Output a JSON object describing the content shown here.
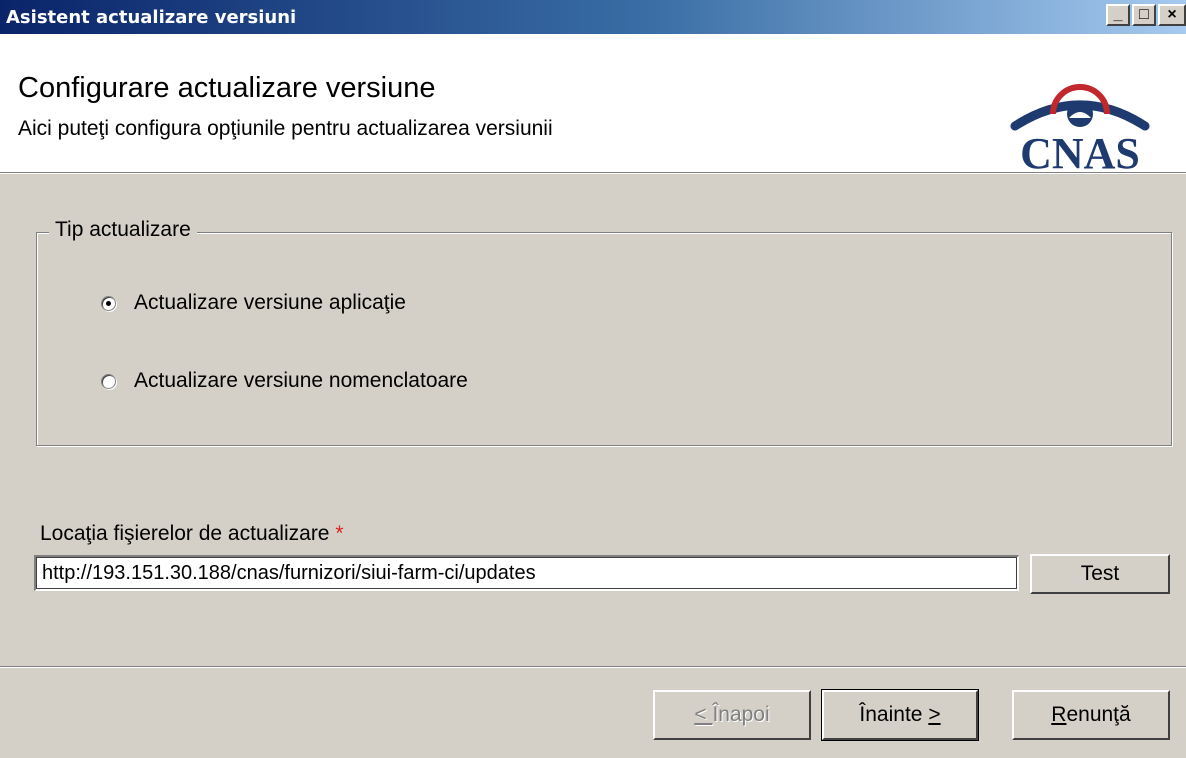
{
  "window": {
    "title": "Asistent actualizare versiuni",
    "controls": [
      "_",
      "□",
      "×"
    ]
  },
  "header": {
    "title": "Configurare actualizare versiune",
    "subtitle": "Aici puteţi configura opţiunile pentru actualizarea versiunii",
    "logo_text": "CNAS"
  },
  "update_type": {
    "legend": "Tip actualizare",
    "options": [
      {
        "label": "Actualizare versiune aplicaţie",
        "selected": true
      },
      {
        "label": "Actualizare versiune nomenclatoare",
        "selected": false
      }
    ]
  },
  "location": {
    "label": "Locaţia fişierelor de actualizare",
    "required_marker": "*",
    "value": "http://193.151.30.188/cnas/furnizori/siui-farm-ci/updates",
    "test_button": "Test"
  },
  "footer": {
    "back_prefix": "< ",
    "back_label": "Înapoi",
    "next_label": "Înainte ",
    "next_suffix": ">",
    "cancel_first": "R",
    "cancel_rest": "enunţă"
  },
  "colors": {
    "titlebar_start": "#0a246a",
    "titlebar_end": "#a6caf0",
    "dialog_bg": "#d4d0c8",
    "logo_navy": "#1f3a6e",
    "logo_red": "#c0282d",
    "required": "#e02020"
  }
}
